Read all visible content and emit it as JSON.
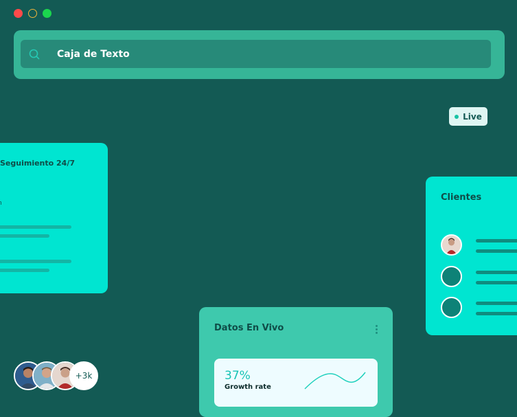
{
  "window": {
    "controls": [
      "close",
      "minimize",
      "maximize"
    ]
  },
  "search": {
    "value": "Caja de Texto",
    "icon": "search-icon"
  },
  "live_badge": {
    "label": "Live"
  },
  "follow_card": {
    "title": "Seguimiento 24/7",
    "fragment": "n"
  },
  "clients_card": {
    "title": "Clientes"
  },
  "live_card": {
    "title": "Datos En Vivo",
    "growth": {
      "value": "37%",
      "label": "Growth rate"
    }
  },
  "avatars": {
    "more_label": "+3k"
  },
  "colors": {
    "background": "#135a54",
    "accent": "#00e5d1",
    "search_outer": "#36b597",
    "search_inner": "#278a79",
    "live_card": "#3ec9ad"
  }
}
